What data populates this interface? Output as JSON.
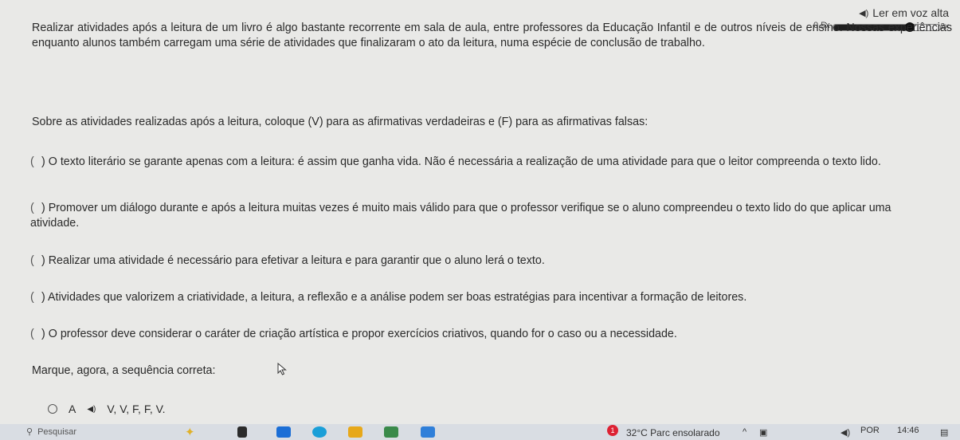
{
  "tts": {
    "label": "Ler em voz alta",
    "speed_min": "0,5x",
    "speed_max": "2x",
    "speed_fraction": 0.72
  },
  "intro": "Realizar atividades após a leitura de um livro é algo bastante recorrente em sala de aula, entre professores da Educação Infantil e de outros níveis de ensino. Nossas experiências enquanto alunos também carregam uma série de atividades que finalizaram o ato da leitura, numa espécie de conclusão de trabalho.",
  "question": "Sobre as atividades realizadas após a leitura, coloque (V) para as afirmativas verdadeiras e (F) para as afirmativas falsas:",
  "items": [
    {
      "paren": "(",
      "text": ") O texto literário se garante apenas com a leitura: é assim que ganha vida. Não é necessária a realização de uma atividade para que o leitor compreenda o texto lido."
    },
    {
      "paren": "(",
      "text": ") Promover um diálogo durante e após a leitura muitas vezes é muito mais válido para que o professor verifique se o aluno compreendeu o texto lido do que aplicar uma atividade."
    },
    {
      "paren": "(",
      "text": ") Realizar uma atividade é necessário para efetivar a leitura e para garantir que o aluno lerá o texto."
    },
    {
      "paren": "(",
      "text": ") Atividades que valorizem a criatividade, a leitura, a reflexão e a análise podem ser boas estratégias para incentivar a formação de leitores."
    },
    {
      "paren": "(",
      "text": ") O professor deve considerar o caráter de criação artística e propor exercícios criativos, quando for o caso ou a necessidade."
    }
  ],
  "prompt": "Marque, agora, a sequência correta:",
  "option": {
    "letter": "A",
    "text": "V, V, F, F, V."
  },
  "taskbar": {
    "search": "Pesquisar",
    "weather": "32°C  Parc ensolarado",
    "lang": "POR",
    "time": "14:46",
    "badge": "1"
  },
  "colors": {
    "fill": "#1f1f1f",
    "taskbar": "#d9dde3"
  }
}
